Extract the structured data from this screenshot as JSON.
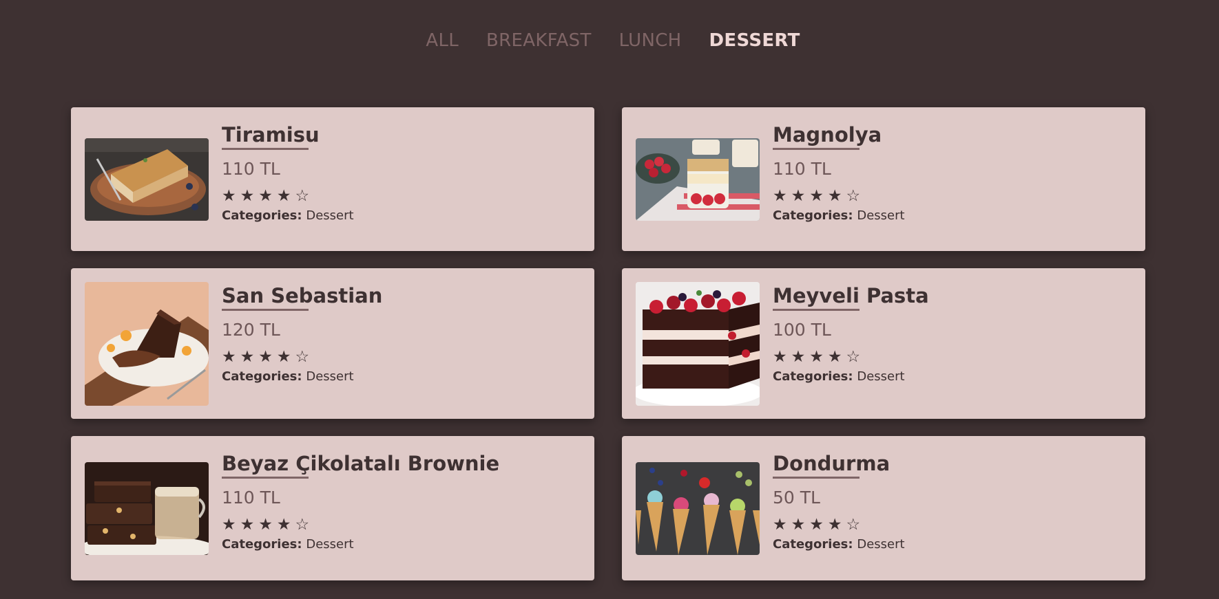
{
  "filters": [
    {
      "label": "ALL",
      "active": false
    },
    {
      "label": "BREAKFAST",
      "active": false
    },
    {
      "label": "LUNCH",
      "active": false
    },
    {
      "label": "DESSERT",
      "active": true
    }
  ],
  "categories_label": "Categories:",
  "items": [
    {
      "title": "Tiramisu",
      "price": "110 TL",
      "rating": 4,
      "max_rating": 5,
      "category": "Dessert",
      "image": "tiramisu-image"
    },
    {
      "title": "Magnolya",
      "price": "110 TL",
      "rating": 4,
      "max_rating": 5,
      "category": "Dessert",
      "image": "magnolya-image"
    },
    {
      "title": "San Sebastian",
      "price": "120 TL",
      "rating": 4,
      "max_rating": 5,
      "category": "Dessert",
      "image": "san-sebastian-image"
    },
    {
      "title": "Meyveli Pasta",
      "price": "100 TL",
      "rating": 4,
      "max_rating": 5,
      "category": "Dessert",
      "image": "meyveli-pasta-image"
    },
    {
      "title": "Beyaz Çikolatalı Brownie",
      "price": "110 TL",
      "rating": 4,
      "max_rating": 5,
      "category": "Dessert",
      "image": "brownie-image"
    },
    {
      "title": "Dondurma",
      "price": "50 TL",
      "rating": 4,
      "max_rating": 5,
      "category": "Dessert",
      "image": "dondurma-image"
    }
  ],
  "colors": {
    "background": "#3e3132",
    "card": "#dfcac8",
    "filter_inactive": "#7f6566",
    "filter_active": "#efd8d6",
    "text": "#3e3132"
  }
}
